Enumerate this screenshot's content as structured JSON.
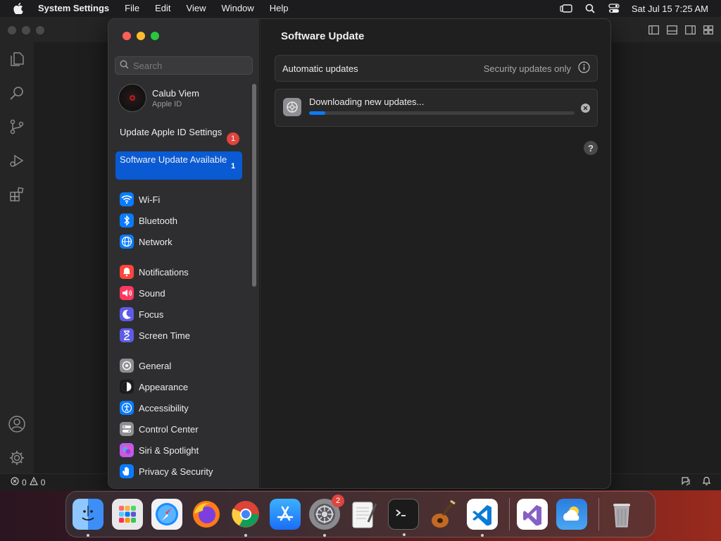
{
  "menubar": {
    "app_name": "System Settings",
    "items": [
      "File",
      "Edit",
      "View",
      "Window",
      "Help"
    ],
    "clock": "Sat Jul 15  7:25 AM"
  },
  "statusbar": {
    "errors": "0",
    "warnings": "0"
  },
  "sidebar": {
    "search_placeholder": "Search",
    "profile": {
      "name": "Calub Viem",
      "subtitle": "Apple ID"
    },
    "notices": [
      {
        "label": "Update Apple ID Settings",
        "badge": "1"
      },
      {
        "label": "Software Update Available",
        "badge": "1"
      }
    ],
    "groups": [
      [
        {
          "label": "Wi-Fi",
          "icon": "wifi-icon",
          "color": "#0a7bff"
        },
        {
          "label": "Bluetooth",
          "icon": "bluetooth-icon",
          "color": "#0a7bff"
        },
        {
          "label": "Network",
          "icon": "globe-icon",
          "color": "#0a7bff"
        }
      ],
      [
        {
          "label": "Notifications",
          "icon": "bell-icon",
          "color": "#ff453a"
        },
        {
          "label": "Sound",
          "icon": "speaker-icon",
          "color": "#ff375f"
        },
        {
          "label": "Focus",
          "icon": "moon-icon",
          "color": "#5e5ce6"
        },
        {
          "label": "Screen Time",
          "icon": "hourglass-icon",
          "color": "#5e5ce6"
        }
      ],
      [
        {
          "label": "General",
          "icon": "gear-icon",
          "color": "#8e8e93"
        },
        {
          "label": "Appearance",
          "icon": "appearance-icon",
          "color": "#1c1c1e"
        },
        {
          "label": "Accessibility",
          "icon": "accessibility-icon",
          "color": "#0a7bff"
        },
        {
          "label": "Control Center",
          "icon": "toggles-icon",
          "color": "#8e8e93"
        },
        {
          "label": "Siri & Spotlight",
          "icon": "siri-icon",
          "color": "#bf5af2"
        },
        {
          "label": "Privacy & Security",
          "icon": "hand-icon",
          "color": "#0a7bff"
        }
      ]
    ]
  },
  "content": {
    "title": "Software Update",
    "automatic_updates": {
      "label": "Automatic updates",
      "value": "Security updates only"
    },
    "download": {
      "text": "Downloading new updates...",
      "progress": 0.06
    },
    "help": "?"
  },
  "dock": {
    "apps": [
      {
        "name": "finder",
        "color": "#3d8ef7",
        "running": true
      },
      {
        "name": "launchpad",
        "color": "#d8d8d8",
        "running": false
      },
      {
        "name": "safari",
        "color": "#e9e9ea",
        "running": false
      },
      {
        "name": "firefox",
        "color": "#7b3fe0",
        "running": false
      },
      {
        "name": "chrome",
        "color": "#ffffff",
        "running": true
      },
      {
        "name": "app-store",
        "color": "#1a8cff",
        "running": false
      },
      {
        "name": "system-settings",
        "color": "#8a8a8f",
        "running": true,
        "badge": "2"
      },
      {
        "name": "textedit",
        "color": "#f2f2f2",
        "running": false
      },
      {
        "name": "terminal",
        "color": "#1b1b1b",
        "running": true
      },
      {
        "name": "garageband",
        "color": "#3a2a20",
        "running": false
      },
      {
        "name": "vscode",
        "color": "#ffffff",
        "running": true
      }
    ],
    "apps_after_separator": [
      {
        "name": "visual-studio",
        "color": "#ffffff",
        "running": false
      },
      {
        "name": "weather",
        "color": "#3a8de0",
        "running": false
      }
    ],
    "trash": {
      "name": "trash",
      "color": "#b8b8b8"
    }
  }
}
